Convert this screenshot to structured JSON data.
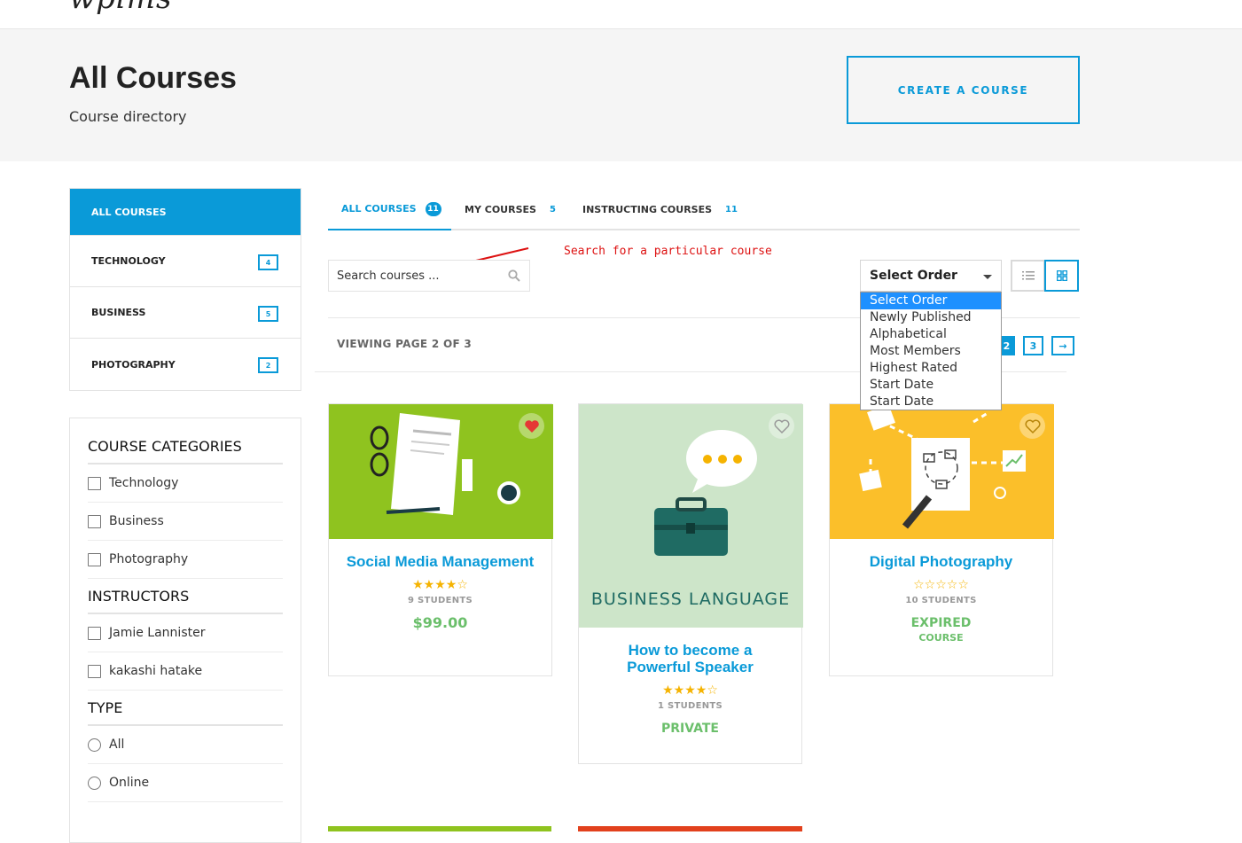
{
  "brand": {
    "logo_text": "wplms"
  },
  "header": {
    "title": "All Courses",
    "subtitle": "Course directory",
    "create_button": "CREATE A COURSE"
  },
  "sidebar": {
    "items": [
      {
        "label": "ALL COURSES",
        "count": ""
      },
      {
        "label": "TECHNOLOGY",
        "count": "4"
      },
      {
        "label": "BUSINESS",
        "count": "5"
      },
      {
        "label": "PHOTOGRAPHY",
        "count": "2"
      }
    ]
  },
  "filters": {
    "categories_heading": "COURSE CATEGORIES",
    "categories": [
      "Technology",
      "Business",
      "Photography"
    ],
    "instructors_heading": "INSTRUCTORS",
    "instructors": [
      "Jamie Lannister",
      "kakashi hatake"
    ],
    "type_heading": "TYPE",
    "types": [
      "All",
      "Online"
    ]
  },
  "tabs": [
    {
      "label": "ALL COURSES",
      "count": "11"
    },
    {
      "label": "MY COURSES",
      "count": "5"
    },
    {
      "label": "INSTRUCTING COURSES",
      "count": "11"
    }
  ],
  "annotation": "Search for a particular course",
  "search": {
    "placeholder": "Search courses ..."
  },
  "order": {
    "selected": "Select Order",
    "options": [
      "Select Order",
      "Newly Published",
      "Alphabetical",
      "Most Members",
      "Highest Rated",
      "Start Date",
      "Start Date"
    ]
  },
  "pagination": {
    "viewing": "VIEWING PAGE 2 OF 3",
    "current": "2",
    "next_page": "3",
    "next_arrow": "→"
  },
  "courses": [
    {
      "title": "Social Media Management",
      "rating": 4,
      "students": "9 STUDENTS",
      "status": "$99.00",
      "status_sub": "",
      "favorited": true,
      "image_color": "#8fc31f"
    },
    {
      "title": "How to become a Powerful Speaker",
      "rating": 4,
      "students": "1 STUDENTS",
      "status": "PRIVATE",
      "status_sub": "",
      "favorited": false,
      "image_text": "BUSINESS LANGUAGE",
      "image_color": "#cde5c9"
    },
    {
      "title": "Digital Photography",
      "rating": 0,
      "students": "10 STUDENTS",
      "status": "EXPIRED",
      "status_sub": "COURSE",
      "favorited": false,
      "image_color": "#fbbf2a"
    }
  ],
  "colors": {
    "accent": "#0a9ad8",
    "success": "#6bbf6b",
    "star": "#f5b301",
    "annotation": "#dd1111"
  }
}
